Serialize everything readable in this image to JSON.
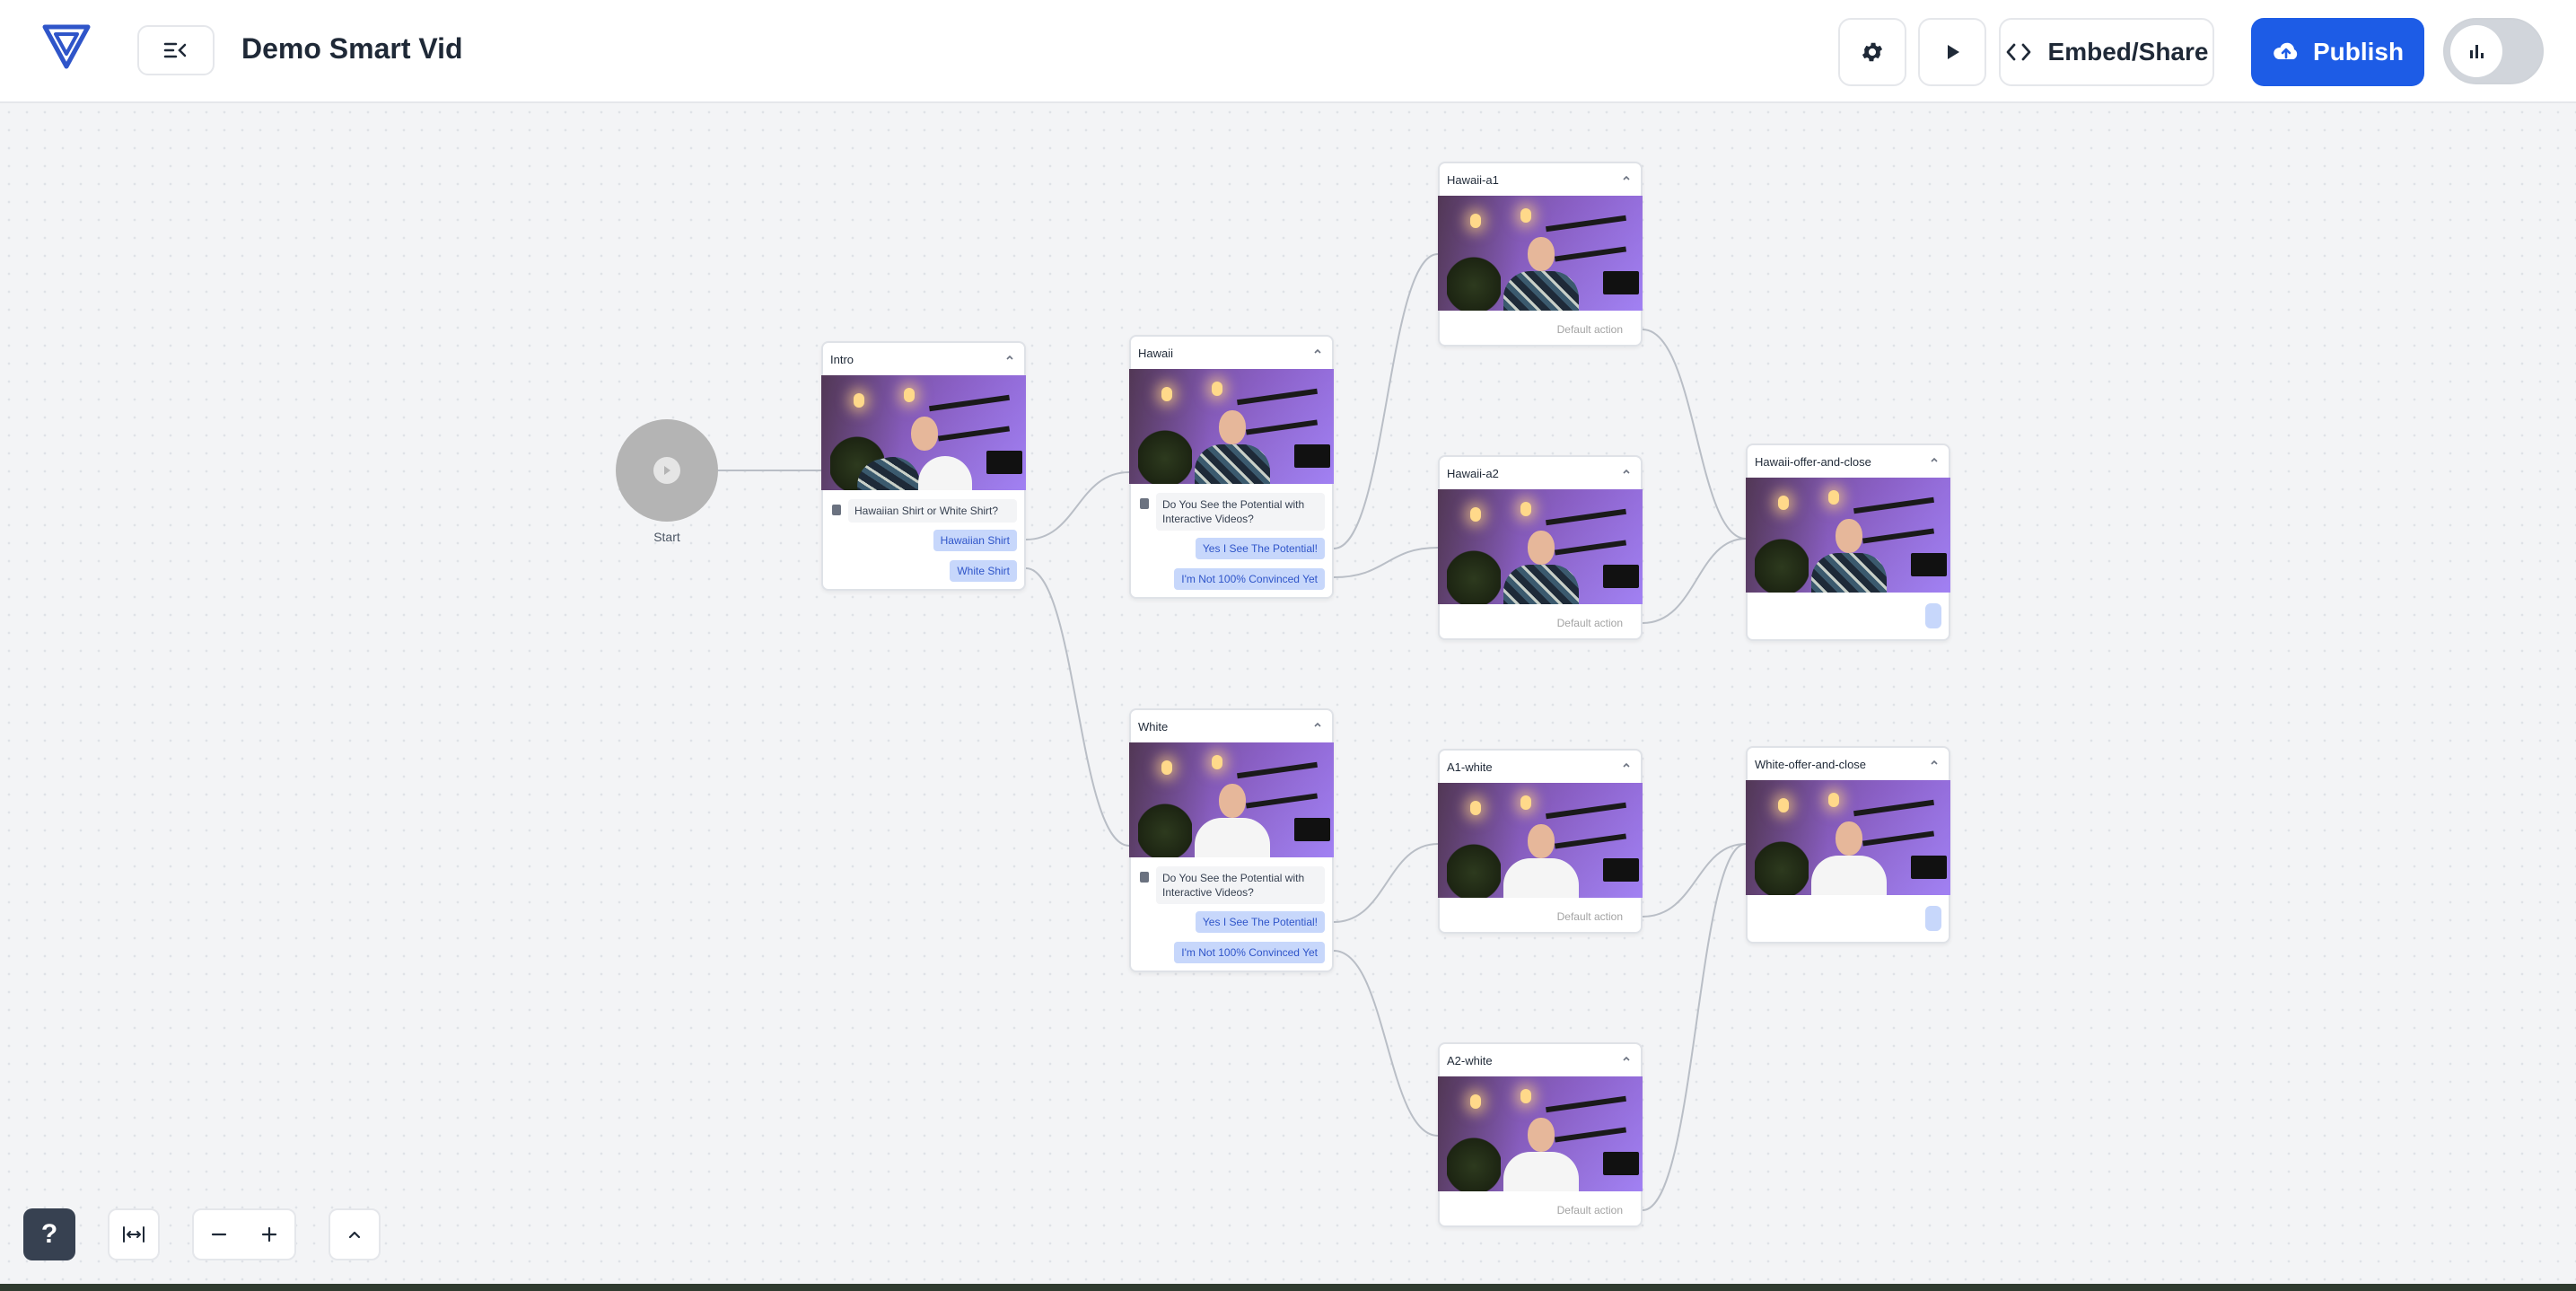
{
  "header": {
    "title": "Demo Smart Vid",
    "embed_label": "Embed/Share",
    "publish_label": "Publish"
  },
  "colors": {
    "accent": "#1d5ce6",
    "option_bg": "#c7d7fb",
    "option_text": "#2f55c9"
  },
  "start": {
    "label": "Start"
  },
  "nodes": {
    "intro": {
      "title": "Intro",
      "question": "Hawaiian Shirt or White Shirt?",
      "options": [
        "Hawaiian Shirt",
        "White Shirt"
      ]
    },
    "hawaii": {
      "title": "Hawaii",
      "question": "Do You See the Potential with Interactive Videos?",
      "options": [
        "Yes I See The Potential!",
        "I'm Not 100% Convinced Yet"
      ]
    },
    "white": {
      "title": "White",
      "question": "Do You See the Potential with Interactive Videos?",
      "options": [
        "Yes I See The Potential!",
        "I'm Not 100% Convinced Yet"
      ]
    },
    "hawaii_a1": {
      "title": "Hawaii-a1",
      "footer": "Default action"
    },
    "hawaii_a2": {
      "title": "Hawaii-a2",
      "footer": "Default action"
    },
    "a1_white": {
      "title": "A1-white",
      "footer": "Default action"
    },
    "a2_white": {
      "title": "A2-white",
      "footer": "Default action"
    },
    "hawaii_offer": {
      "title": "Hawaii-offer-and-close"
    },
    "white_offer": {
      "title": "White-offer-and-close"
    }
  },
  "controls": {
    "help_label": "?",
    "icons": [
      "fit-view-icon",
      "zoom-out-icon",
      "zoom-in-icon",
      "chevron-up-icon"
    ]
  }
}
